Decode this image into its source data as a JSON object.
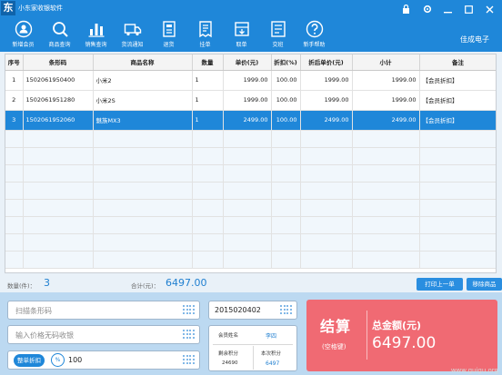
{
  "app": {
    "logo": "东",
    "title": "小东家收银软件",
    "company": "佳成电子"
  },
  "window_controls": [
    "lock-icon",
    "settings-icon",
    "minimize-icon",
    "maximize-icon",
    "close-icon"
  ],
  "toolbar": [
    {
      "label": "新增会员",
      "icon": "add-member-icon"
    },
    {
      "label": "商品查询",
      "icon": "search-icon"
    },
    {
      "label": "销售查询",
      "icon": "bar-chart-icon"
    },
    {
      "label": "货流通知",
      "icon": "truck-icon"
    },
    {
      "label": "退货",
      "icon": "return-icon"
    },
    {
      "label": "挂单",
      "icon": "hold-order-icon"
    },
    {
      "label": "取单",
      "icon": "retrieve-order-icon"
    },
    {
      "label": "交班",
      "icon": "shift-icon"
    },
    {
      "label": "新手帮助",
      "icon": "help-icon"
    }
  ],
  "table": {
    "headers": [
      "序号",
      "条形码",
      "商品名称",
      "数量",
      "单价(元)",
      "折扣(%)",
      "折后单价(元)",
      "小计",
      "备注"
    ],
    "rows": [
      {
        "no": "1",
        "barcode": "1502061950400",
        "name": "小米2",
        "qty": "1",
        "price": "1999.00",
        "discount": "100.00",
        "discounted": "1999.00",
        "subtotal": "1999.00",
        "note": "【会员折扣】"
      },
      {
        "no": "2",
        "barcode": "1502061951280",
        "name": "小米2S",
        "qty": "1",
        "price": "1999.00",
        "discount": "100.00",
        "discounted": "1999.00",
        "subtotal": "1999.00",
        "note": "【会员折扣】"
      },
      {
        "no": "3",
        "barcode": "1502061952060",
        "name": "魅族MX3",
        "qty": "1",
        "price": "2499.00",
        "discount": "100.00",
        "discounted": "2499.00",
        "subtotal": "2499.00",
        "note": "【会员折扣】"
      }
    ],
    "selected_row": 3
  },
  "totals": {
    "qty_label": "数量(件)：",
    "qty": "3",
    "sum_label": "合计(元)：",
    "sum": "6497.00"
  },
  "buttons": {
    "print_last": "打印上一单",
    "remove_item": "移除商品"
  },
  "inputs": {
    "barcode_placeholder": "扫描条形码",
    "price_placeholder": "输入价格无码收银",
    "discount_tag": "整单折扣",
    "discount_unit": "%",
    "discount_value": "100",
    "member_id": "2015020402"
  },
  "member": {
    "name_label": "会员姓名",
    "name": "李四",
    "points_label": "剩余积分",
    "points": "24690",
    "this_points_label": "本次积分",
    "this_points": "6497"
  },
  "checkout": {
    "title": "结算",
    "subtitle": "(空格键)",
    "total_label": "总金额(元)",
    "total": "6497.00"
  },
  "watermark": "www.guigu.org",
  "colors": {
    "header": "#1f87d9",
    "selected_row": "#1f87d9",
    "checkout": "#f06a73",
    "accent_text": "#1f7fd0"
  }
}
